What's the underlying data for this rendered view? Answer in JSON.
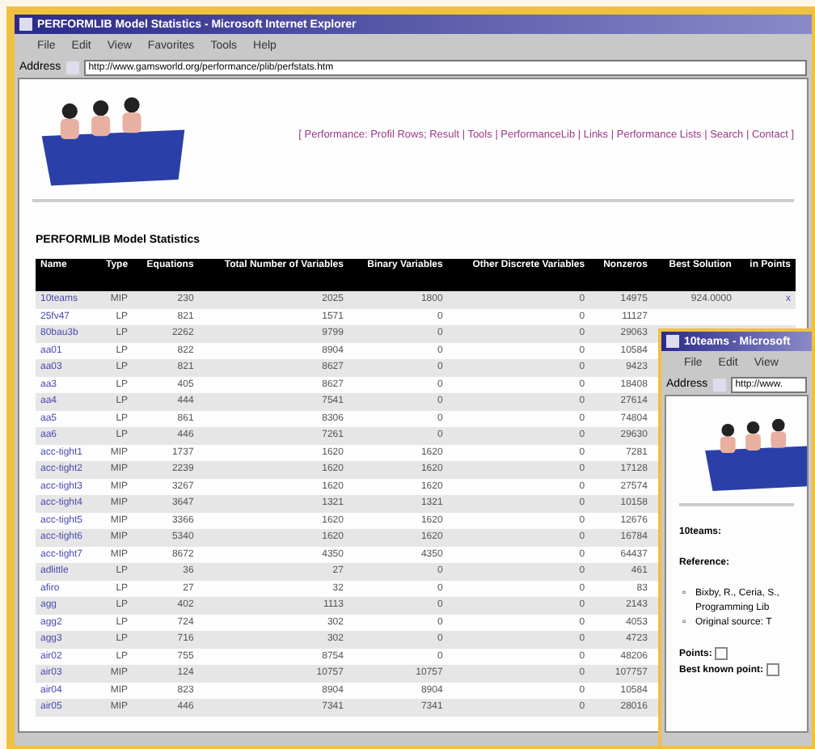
{
  "main_window": {
    "title": "PERFORMLIB Model Statistics - Microsoft Internet Explorer",
    "menu": [
      "File",
      "Edit",
      "View",
      "Favorites",
      "Tools",
      "Help"
    ],
    "address_label": "Address",
    "address": "http://www.gamsworld.org/performance/plib/perfstats.htm",
    "nav_links": [
      "[ Performance: Profil Rows; Result",
      "| Tools",
      "| PerformanceLib",
      "| Links",
      "| Performance Lists",
      "| Search |",
      "Contact ]"
    ],
    "page_title": "PERFORMLIB Model Statistics",
    "table": {
      "columns": [
        "Name",
        "Type",
        "Equations",
        "Total Number of Variables",
        "Binary Variables",
        "Other Discrete Variables",
        "Nonzeros",
        "Best Solution",
        "in Points"
      ],
      "rows": [
        [
          "10teams",
          "MIP",
          "230",
          "2025",
          "1800",
          "0",
          "14975",
          "924.0000",
          "x"
        ],
        [
          "25fv47",
          "LP",
          "821",
          "1571",
          "0",
          "0",
          "11127",
          "",
          ""
        ],
        [
          "80bau3b",
          "LP",
          "2262",
          "9799",
          "0",
          "0",
          "29063",
          "",
          ""
        ],
        [
          "aa01",
          "LP",
          "822",
          "8904",
          "0",
          "0",
          "10584",
          "",
          ""
        ],
        [
          "aa03",
          "LP",
          "821",
          "8627",
          "0",
          "0",
          "9423",
          "",
          ""
        ],
        [
          "aa3",
          "LP",
          "405",
          "8627",
          "0",
          "0",
          "18408",
          "",
          ""
        ],
        [
          "aa4",
          "LP",
          "444",
          "7541",
          "0",
          "0",
          "27614",
          "",
          ""
        ],
        [
          "aa5",
          "LP",
          "861",
          "8306",
          "0",
          "0",
          "74804",
          "",
          ""
        ],
        [
          "aa6",
          "LP",
          "446",
          "7261",
          "0",
          "0",
          "29630",
          "",
          ""
        ],
        [
          "acc-tight1",
          "MIP",
          "1737",
          "1620",
          "1620",
          "0",
          "7281",
          "",
          ""
        ],
        [
          "acc-tight2",
          "MIP",
          "2239",
          "1620",
          "1620",
          "0",
          "17128",
          "",
          ""
        ],
        [
          "acc-tight3",
          "MIP",
          "3267",
          "1620",
          "1620",
          "0",
          "27574",
          "",
          ""
        ],
        [
          "acc-tight4",
          "MIP",
          "3647",
          "1321",
          "1321",
          "0",
          "10158",
          "",
          ""
        ],
        [
          "acc-tight5",
          "MIP",
          "3366",
          "1620",
          "1620",
          "0",
          "12676",
          "",
          ""
        ],
        [
          "acc-tight6",
          "MIP",
          "5340",
          "1620",
          "1620",
          "0",
          "16784",
          "",
          ""
        ],
        [
          "acc-tight7",
          "MIP",
          "8672",
          "4350",
          "4350",
          "0",
          "64437",
          "",
          ""
        ],
        [
          "adlittle",
          "LP",
          "36",
          "27",
          "0",
          "0",
          "461",
          "",
          ""
        ],
        [
          "afiro",
          "LP",
          "27",
          "32",
          "0",
          "0",
          "83",
          "",
          ""
        ],
        [
          "agg",
          "LP",
          "402",
          "1113",
          "0",
          "0",
          "2143",
          "",
          ""
        ],
        [
          "agg2",
          "LP",
          "724",
          "302",
          "0",
          "0",
          "4053",
          "",
          ""
        ],
        [
          "agg3",
          "LP",
          "716",
          "302",
          "0",
          "0",
          "4723",
          "",
          ""
        ],
        [
          "air02",
          "LP",
          "755",
          "8754",
          "0",
          "0",
          "48206",
          "",
          ""
        ],
        [
          "air03",
          "MIP",
          "124",
          "10757",
          "10757",
          "0",
          "107757",
          "",
          ""
        ],
        [
          "air04",
          "MIP",
          "823",
          "8904",
          "8904",
          "0",
          "10584",
          "",
          ""
        ],
        [
          "air05",
          "MIP",
          "446",
          "7341",
          "7341",
          "0",
          "28016",
          "",
          ""
        ]
      ]
    }
  },
  "second_window": {
    "title": "10teams - Microsoft",
    "menu": [
      "File",
      "Edit",
      "View"
    ],
    "address_label": "Address",
    "address": "http://www.",
    "model_name": "10teams:",
    "reference_label": "Reference:",
    "references": [
      {
        "bullet": "▫",
        "text": "Bixby, R., Ceria, S.,"
      },
      {
        "text": "Programming Lib"
      },
      {
        "bullet": "▫",
        "text": "Original source: T"
      }
    ],
    "points_label": "Points:",
    "best_point_label": "Best known point:"
  }
}
